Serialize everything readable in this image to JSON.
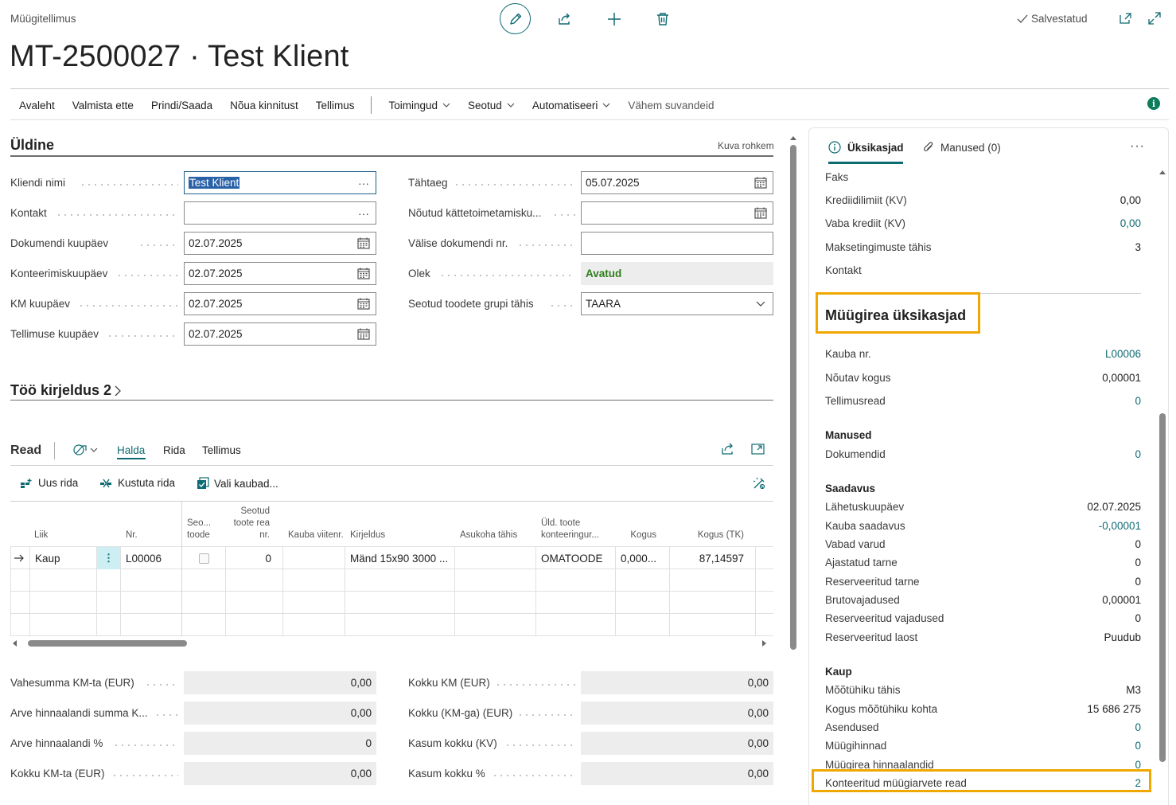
{
  "header": {
    "caption": "Müügitellimus",
    "title": "MT-2500027 · Test Klient",
    "saved": "Salvestatud"
  },
  "actions": [
    {
      "label": "Avaleht",
      "menu": false
    },
    {
      "label": "Valmista ette",
      "menu": false
    },
    {
      "label": "Prindi/Saada",
      "menu": false
    },
    {
      "label": "Nõua kinnitust",
      "menu": false
    },
    {
      "label": "Tellimus",
      "menu": false
    },
    {
      "label": "Toimingud",
      "menu": true
    },
    {
      "label": "Seotud",
      "menu": true
    },
    {
      "label": "Automatiseeri",
      "menu": true
    },
    {
      "label": "Vähem suvandeid",
      "menu": false
    }
  ],
  "general": {
    "title": "Üldine",
    "show_more": "Kuva rohkem",
    "left_fields": [
      {
        "label": "Kliendi nimi",
        "value": "Test Klient",
        "button": "ellipsis"
      },
      {
        "label": "Kontakt",
        "value": "",
        "button": "ellipsis"
      },
      {
        "label": "Dokumendi kuupäev",
        "value": "02.07.2025",
        "button": "calendar"
      },
      {
        "label": "Konteerimiskuupäev",
        "value": "02.07.2025",
        "button": "calendar"
      },
      {
        "label": "KM kuupäev",
        "value": "02.07.2025",
        "button": "calendar"
      },
      {
        "label": "Tellimuse kuupäev",
        "value": "02.07.2025",
        "button": "calendar"
      }
    ],
    "right_fields": [
      {
        "label": "Tähtaeg",
        "value": "05.07.2025",
        "button": "calendar"
      },
      {
        "label": "Nõutud kättetoimetamisku...",
        "value": "",
        "button": "calendar"
      },
      {
        "label": "Välise dokumendi nr.",
        "value": "",
        "button": "none"
      },
      {
        "label": "Olek",
        "value": "Avatud",
        "button": "static"
      },
      {
        "label": "Seotud toodete grupi tähis",
        "value": "TAARA",
        "button": "dropdown"
      }
    ]
  },
  "work_description": {
    "title": "Töö kirjeldus 2"
  },
  "lines": {
    "title": "Read",
    "tabs": [
      "Halda",
      "Rida",
      "Tellimus"
    ],
    "actions": [
      "Uus rida",
      "Kustuta rida",
      "Vali kaubad..."
    ],
    "columns": [
      "Liik",
      "Nr.",
      "Seo... toode",
      "Seotud toote rea nr.",
      "Kauba viitenr.",
      "Kirjeldus",
      "Asukoha tähis",
      "Üld. toote konteeringur...",
      "Kogus",
      "Kogus (TK)"
    ],
    "rows": [
      {
        "type": "Kaup",
        "no": "L00006",
        "linked": false,
        "linked_line": "0",
        "ref": "",
        "description": "Mänd 15x90 3000 ...",
        "location": "",
        "posting_group": "OMATOODE",
        "qty": "0,000...",
        "qty_tk": "87,14597"
      }
    ]
  },
  "totals": {
    "left": [
      {
        "label": "Vahesumma KM-ta (EUR)",
        "value": "0,00"
      },
      {
        "label": "Arve hinnaalandi summa K...",
        "value": "0,00"
      },
      {
        "label": "Arve hinnaalandi %",
        "value": "0"
      },
      {
        "label": "Kokku KM-ta (EUR)",
        "value": "0,00"
      }
    ],
    "right": [
      {
        "label": "Kokku KM (EUR)",
        "value": "0,00"
      },
      {
        "label": "Kokku (KM-ga) (EUR)",
        "value": "0,00"
      },
      {
        "label": "Kasum kokku (KV)",
        "value": "0,00"
      },
      {
        "label": "Kasum kokku %",
        "value": "0,00"
      }
    ]
  },
  "factbox": {
    "tabs": [
      "Üksikasjad",
      "Manused (0)"
    ],
    "customer_rows": [
      {
        "label": "Faks",
        "value": "",
        "link": false
      },
      {
        "label": "Krediidilimiit (KV)",
        "value": "0,00",
        "link": false
      },
      {
        "label": "Vaba krediit (KV)",
        "value": "0,00",
        "link": true
      },
      {
        "label": "Maksetingimuste tähis",
        "value": "3",
        "link": false
      },
      {
        "label": "Kontakt",
        "value": "",
        "link": false
      }
    ],
    "section_title": "Müügirea üksikasjad",
    "item_rows": [
      {
        "label": "Kauba nr.",
        "value": "L00006",
        "link": true
      },
      {
        "label": "Nõutav kogus",
        "value": "0,00001",
        "link": false
      },
      {
        "label": "Tellimusread",
        "value": "0",
        "link": true
      }
    ],
    "attachments_group": "Manused",
    "attachments_rows": [
      {
        "label": "Dokumendid",
        "value": "0",
        "link": true
      }
    ],
    "availability_group": "Saadavus",
    "availability_rows": [
      {
        "label": "Lähetuskuupäev",
        "value": "02.07.2025",
        "link": false
      },
      {
        "label": "Kauba saadavus",
        "value": "-0,00001",
        "link": true
      },
      {
        "label": "Vabad varud",
        "value": "0",
        "link": false
      },
      {
        "label": "Ajastatud tarne",
        "value": "0",
        "link": false
      },
      {
        "label": "Reserveeritud tarne",
        "value": "0",
        "link": false
      },
      {
        "label": "Brutovajadused",
        "value": "0,00001",
        "link": false
      },
      {
        "label": "Reserveeritud vajadused",
        "value": "0",
        "link": false
      },
      {
        "label": "Reserveeritud laost",
        "value": "Puudub",
        "link": false
      }
    ],
    "item_group": "Kaup",
    "item_detail_rows": [
      {
        "label": "Mõõtühiku tähis",
        "value": "M3",
        "link": false
      },
      {
        "label": "Kogus mõõtühiku kohta",
        "value": "15 686 275",
        "link": false
      },
      {
        "label": "Asendused",
        "value": "0",
        "link": true
      },
      {
        "label": "Müügihinnad",
        "value": "0",
        "link": true
      },
      {
        "label": "Müügirea hinnaalandid",
        "value": "0",
        "link": true
      },
      {
        "label": "Konteeritud müügiarvete read",
        "value": "2",
        "link": true
      }
    ]
  },
  "colors": {
    "accent": "#0f6b72",
    "highlight": "#f0a800",
    "status_ok": "#2e7d1b",
    "selection": "#2a62a8"
  },
  "icons": [
    "edit-icon",
    "share-icon",
    "plus-icon",
    "trash-icon",
    "check-icon",
    "open-in-new-window-icon",
    "expand-icon",
    "info-icon",
    "calendar-icon",
    "ellipsis-icon",
    "chevron-down-icon",
    "chevron-right-icon",
    "arrow-right-icon",
    "paperclip-icon",
    "views-icon",
    "personalize-icon"
  ]
}
